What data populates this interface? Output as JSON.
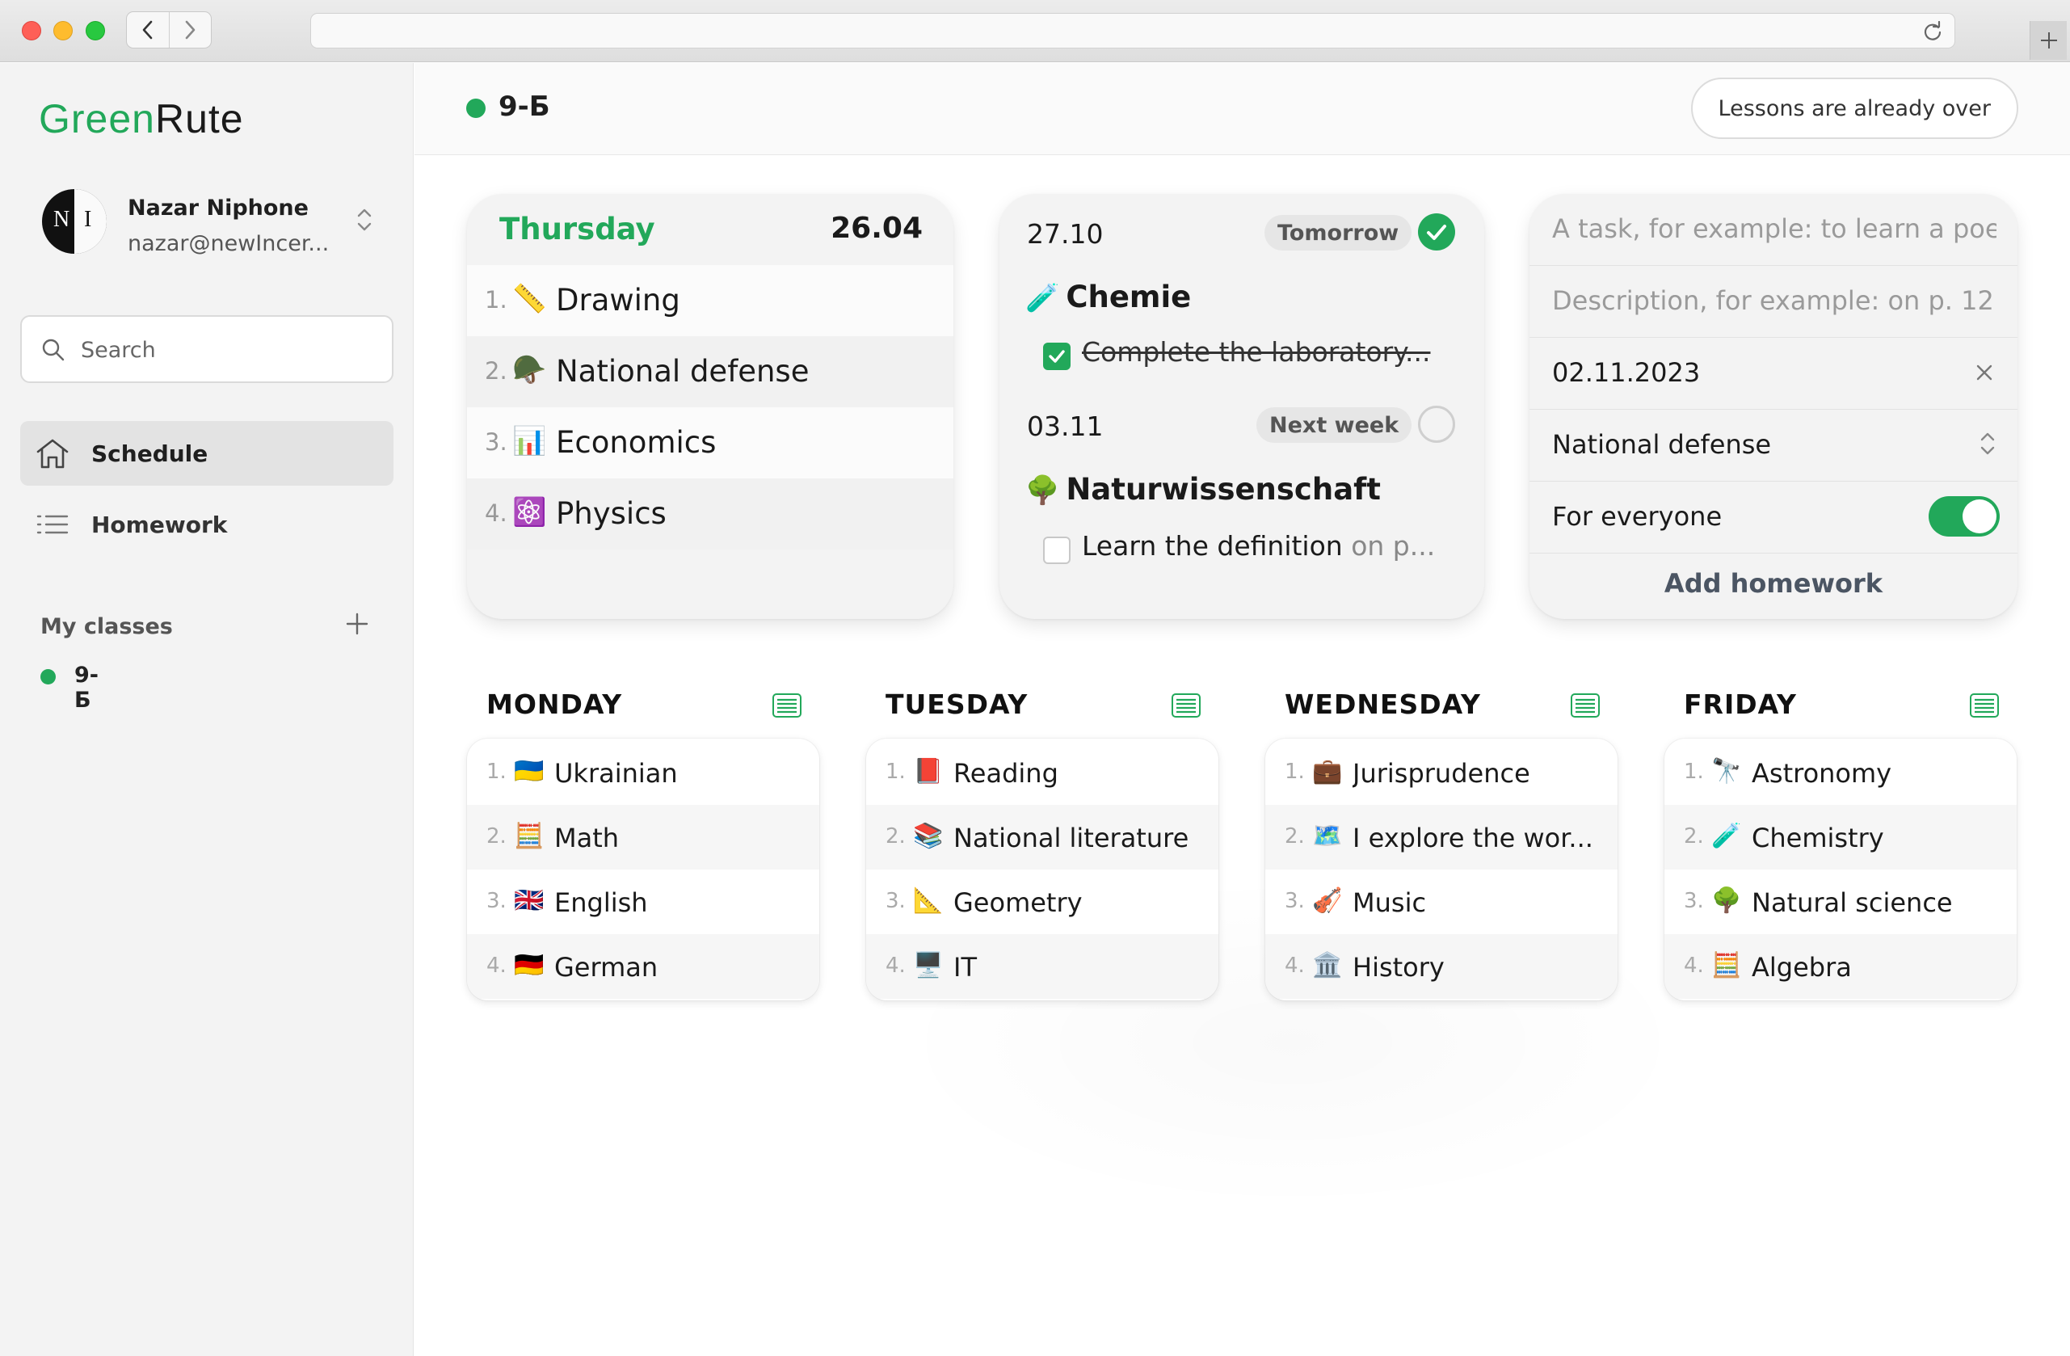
{
  "app": {
    "logo_green": "Green",
    "logo_dark": "Rute"
  },
  "profile": {
    "name": "Nazar Niphone",
    "email": "nazar@newIncer...",
    "avatar_letters": [
      "N",
      "I"
    ]
  },
  "search": {
    "placeholder": "Search"
  },
  "nav": [
    {
      "label": "Schedule",
      "icon": "home-icon",
      "active": true
    },
    {
      "label": "Homework",
      "icon": "list-icon",
      "active": false
    }
  ],
  "classes": {
    "title": "My classes",
    "items": [
      {
        "label": "9-Б"
      }
    ]
  },
  "topbar": {
    "class_label": "9-Б",
    "status": "Lessons are already over"
  },
  "today": {
    "day": "Thursday",
    "date": "26.04",
    "lessons": [
      {
        "num": "1.",
        "emoji": "📏",
        "subject": "Drawing"
      },
      {
        "num": "2.",
        "emoji": "🪖",
        "subject": "National defense"
      },
      {
        "num": "3.",
        "emoji": "📊",
        "subject": "Economics"
      },
      {
        "num": "4.",
        "emoji": "⚛️",
        "subject": "Physics"
      }
    ]
  },
  "homework": [
    {
      "date": "27.10",
      "when": "Tomorrow",
      "done": true,
      "emoji": "🧪",
      "subject": "Chemie",
      "task": "Complete the laboratory...",
      "task_desc": ""
    },
    {
      "date": "03.11",
      "when": "Next week",
      "done": false,
      "emoji": "🌳",
      "subject": "Naturwissenschaft",
      "task": "Learn the definition",
      "task_desc": " on p..."
    }
  ],
  "form": {
    "task_placeholder": "A task, for example: to learn a poe",
    "desc_placeholder": "Description, for example: on p. 12..",
    "date_value": "02.11.2023",
    "subject_value": "National defense",
    "everyone_label": "For everyone",
    "everyone_on": true,
    "submit_label": "Add homework"
  },
  "week": [
    {
      "day": "MONDAY",
      "lessons": [
        {
          "num": "1.",
          "emoji": "🇺🇦",
          "subject": "Ukrainian"
        },
        {
          "num": "2.",
          "emoji": "🧮",
          "subject": "Math"
        },
        {
          "num": "3.",
          "emoji": "🇬🇧",
          "subject": "English"
        },
        {
          "num": "4.",
          "emoji": "🇩🇪",
          "subject": "German"
        }
      ]
    },
    {
      "day": "TUESDAY",
      "lessons": [
        {
          "num": "1.",
          "emoji": "📕",
          "subject": "Reading"
        },
        {
          "num": "2.",
          "emoji": "📚",
          "subject": "National literature"
        },
        {
          "num": "3.",
          "emoji": "📐",
          "subject": "Geometry"
        },
        {
          "num": "4.",
          "emoji": "🖥️",
          "subject": "IT"
        }
      ]
    },
    {
      "day": "WEDNESDAY",
      "lessons": [
        {
          "num": "1.",
          "emoji": "💼",
          "subject": "Jurisprudence"
        },
        {
          "num": "2.",
          "emoji": "🗺️",
          "subject": "I explore the wor..."
        },
        {
          "num": "3.",
          "emoji": "🎻",
          "subject": "Music"
        },
        {
          "num": "4.",
          "emoji": "🏛️",
          "subject": "History"
        }
      ]
    },
    {
      "day": "FRIDAY",
      "lessons": [
        {
          "num": "1.",
          "emoji": "🔭",
          "subject": "Astronomy"
        },
        {
          "num": "2.",
          "emoji": "🧪",
          "subject": "Chemistry"
        },
        {
          "num": "3.",
          "emoji": "🌳",
          "subject": "Natural science"
        },
        {
          "num": "4.",
          "emoji": "🧮",
          "subject": "Algebra"
        }
      ]
    }
  ],
  "colors": {
    "accent": "#22a85a"
  }
}
